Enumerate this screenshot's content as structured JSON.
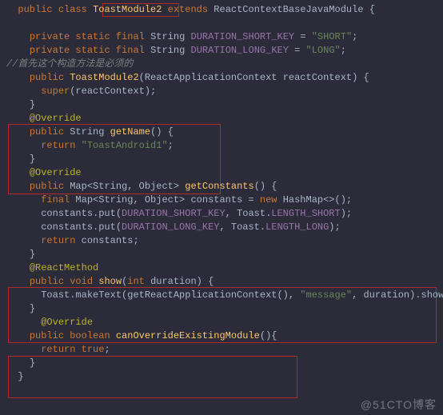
{
  "l1": {
    "a": "public",
    "b": "class",
    "c": "ToastModule2",
    "d": "extends",
    "e": "ReactContextBaseJavaModule",
    "f": " {"
  },
  "l3": {
    "a": "private",
    "b": " static",
    "c": " final",
    "d": " String",
    "e": " DURATION_SHORT_KEY",
    "f": " = ",
    "g": "\"SHORT\"",
    "h": ";"
  },
  "l4": {
    "a": "private",
    "b": " static",
    "c": " final",
    "d": " String",
    "e": " DURATION_LONG_KEY",
    "f": " = ",
    "g": "\"LONG\"",
    "h": ";"
  },
  "l5": {
    "a": "//首先这个构造方法是必须的"
  },
  "l6": {
    "a": "public",
    "b": " ToastModule2",
    "c": "(",
    "d": "ReactApplicationContext",
    "e": " reactContext) {"
  },
  "l7": {
    "a": "super",
    "b": "(reactContext);"
  },
  "l8": {
    "a": "}"
  },
  "l9": {
    "a": "@Override"
  },
  "l10": {
    "a": "public",
    "b": " String",
    "c": " getName",
    "d": "() {"
  },
  "l11": {
    "a": "return ",
    "b": "\"ToastAndroid1\"",
    "c": ";"
  },
  "l12": {
    "a": "}"
  },
  "l13": {
    "a": "@Override"
  },
  "l14": {
    "a": "public",
    "b": " Map<String, Object>",
    "c": " getConstants",
    "d": "() {"
  },
  "l15": {
    "a": "final",
    "b": " Map<String, Object>",
    "c": " constants = ",
    "d": "new",
    "e": " HashMap<>();"
  },
  "l16": {
    "a": "constants.put(",
    "b": "DURATION_SHORT_KEY",
    "c": ", Toast.",
    "d": "LENGTH_SHORT",
    "e": ");"
  },
  "l17": {
    "a": "constants.put(",
    "b": "DURATION_LONG_KEY",
    "c": ", Toast.",
    "d": "LENGTH_LONG",
    "e": ");"
  },
  "l18": {
    "a": "return",
    "b": " constants;"
  },
  "l19": {
    "a": "}"
  },
  "l20": {
    "a": "@ReactMethod"
  },
  "l21": {
    "a": "public",
    "b": " void",
    "c": " show",
    "d": "(",
    "e": "int",
    "f": " duration) {"
  },
  "l22": {
    "a": "Toast.makeText(getReactApplicationContext(), ",
    "b": "\"message\"",
    "c": ", duration).show();"
  },
  "l23": {
    "a": "}"
  },
  "l24": {
    "a": "@Override"
  },
  "l25": {
    "a": "public",
    "b": " boolean",
    "c": " canOverrideExistingModule",
    "d": "(){"
  },
  "l26": {
    "a": "return ",
    "b": "true",
    "c": ";"
  },
  "l27": {
    "a": "}"
  },
  "l28": {
    "a": "}"
  },
  "watermark": "@51CTO博客"
}
